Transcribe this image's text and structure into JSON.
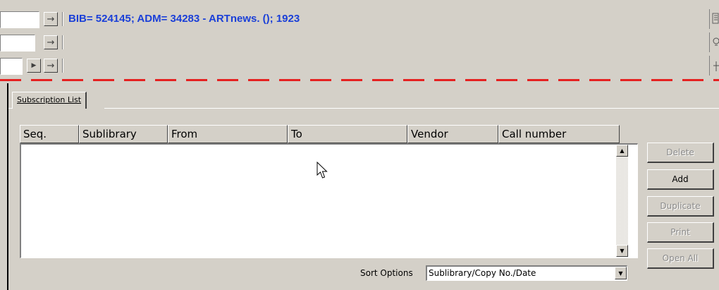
{
  "header": {
    "record_title": "BIB= 524145; ADM= 34283 - ARTnews. (); 1923",
    "arrow_glyph": "→",
    "play_glyph": "▶"
  },
  "tabs": [
    {
      "label": "Subscription List"
    }
  ],
  "list": {
    "columns": [
      "Seq.",
      "Sublibrary",
      "From",
      "To",
      "Vendor",
      "Call number"
    ],
    "rows": []
  },
  "buttons": {
    "delete": "Delete",
    "add": "Add",
    "duplicate": "Duplicate",
    "print": "Print",
    "open_all": "Open All"
  },
  "sort": {
    "label": "Sort Options",
    "selected": "Sublibrary/Copy No./Date"
  },
  "colors": {
    "title_blue": "#1a3fd8",
    "dash_red": "#e52121",
    "window_gray": "#d4d0c8"
  }
}
